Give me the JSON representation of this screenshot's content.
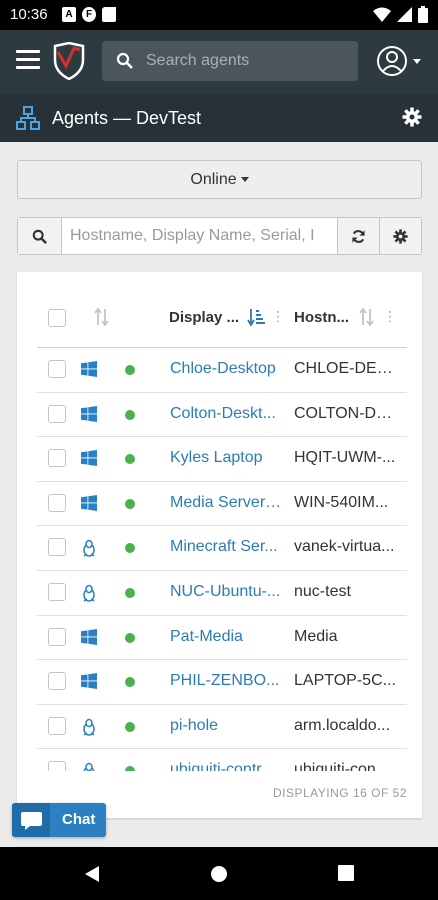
{
  "status_bar": {
    "time": "10:36"
  },
  "nav": {
    "search_placeholder": "Search agents"
  },
  "subheader": {
    "title": "Agents — DevTest"
  },
  "status_filter": {
    "selected": "Online"
  },
  "filter": {
    "placeholder": "Hostname, Display Name, Serial, I"
  },
  "table": {
    "columns": {
      "display_name": "Display ...",
      "hostname": "Hostn..."
    },
    "rows": [
      {
        "os": "windows-icon",
        "status": "online",
        "display_name": "Chloe-Desktop",
        "hostname": "CHLOE-DES..."
      },
      {
        "os": "windows-icon",
        "status": "online",
        "display_name": "Colton-Deskt...",
        "hostname": "COLTON-DE..."
      },
      {
        "os": "windows-icon",
        "status": "online",
        "display_name": "Kyles Laptop",
        "hostname": "HQIT-UWM-..."
      },
      {
        "os": "windows-icon",
        "status": "online",
        "display_name": "Media Server ...",
        "hostname": "WIN-540IM..."
      },
      {
        "os": "linux-icon",
        "status": "online",
        "display_name": "Minecraft Ser...",
        "hostname": "vanek-virtua..."
      },
      {
        "os": "linux-icon",
        "status": "online",
        "display_name": "NUC-Ubuntu-...",
        "hostname": "nuc-test"
      },
      {
        "os": "windows-icon",
        "status": "online",
        "display_name": "Pat-Media",
        "hostname": "Media"
      },
      {
        "os": "windows-icon",
        "status": "online",
        "display_name": "PHIL-ZENBO...",
        "hostname": "LAPTOP-5C..."
      },
      {
        "os": "linux-icon",
        "status": "online",
        "display_name": "pi-hole",
        "hostname": "arm.localdo..."
      },
      {
        "os": "linux-icon",
        "status": "online",
        "display_name": "ubiquiti-contr...",
        "hostname": "ubiquiti-con..."
      }
    ],
    "footer": "DISPLAYING 16 OF 52"
  },
  "chat": {
    "label": "Chat"
  },
  "colors": {
    "online": "#4caf50",
    "link": "#2d7cb5",
    "nav_bg": "#2d3a40",
    "subheader_bg": "#263238",
    "chat": "#2c7fc0",
    "windows": "#2980c4"
  }
}
